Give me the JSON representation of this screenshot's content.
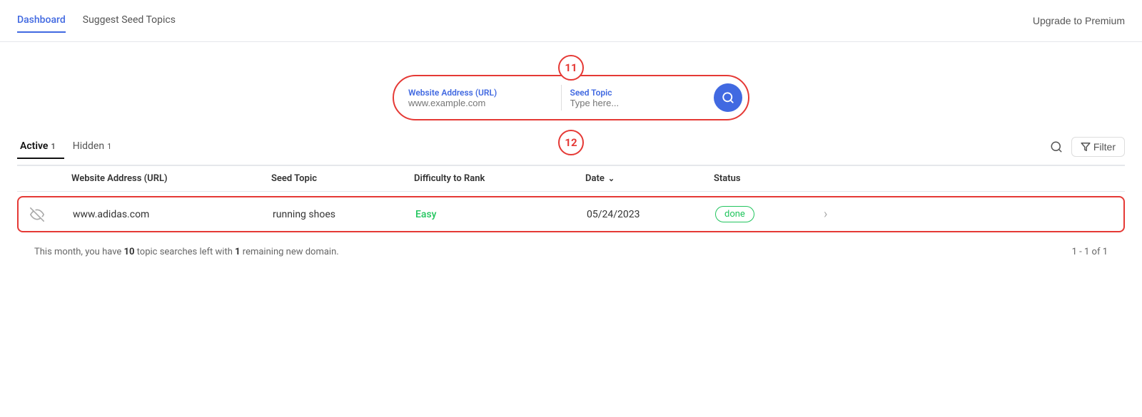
{
  "nav": {
    "tabs": [
      {
        "label": "Dashboard",
        "active": true
      },
      {
        "label": "Suggest Seed Topics",
        "active": false
      }
    ],
    "upgrade_label": "Upgrade to Premium"
  },
  "annotation_11": "11",
  "annotation_12": "12",
  "search": {
    "url_label": "Website Address (URL)",
    "url_placeholder": "www.example.com",
    "topic_label": "Seed Topic",
    "topic_placeholder": "Type here...",
    "btn_aria": "Search"
  },
  "table_tabs": [
    {
      "label": "Active",
      "badge": "1",
      "active": true
    },
    {
      "label": "Hidden",
      "badge": "1",
      "active": false
    }
  ],
  "table_actions": {
    "filter_label": "Filter"
  },
  "table": {
    "headers": [
      {
        "label": "",
        "key": "icon"
      },
      {
        "label": "Website Address (URL)",
        "key": "url"
      },
      {
        "label": "Seed Topic",
        "key": "seed_topic"
      },
      {
        "label": "Difficulty to Rank",
        "key": "difficulty"
      },
      {
        "label": "Date",
        "key": "date",
        "sort": true
      },
      {
        "label": "Status",
        "key": "status"
      },
      {
        "label": "",
        "key": "action"
      }
    ],
    "rows": [
      {
        "icon": "eye-off",
        "url": "www.adidas.com",
        "seed_topic": "running shoes",
        "difficulty": "Easy",
        "difficulty_color": "green",
        "date": "05/24/2023",
        "status": "done",
        "status_type": "done"
      }
    ]
  },
  "footer": {
    "text_start": "This month, you have ",
    "searches_left": "10",
    "text_mid": " topic searches left with ",
    "domains_left": "1",
    "text_end": " remaining new domain.",
    "pagination": "1 - 1 of 1"
  }
}
